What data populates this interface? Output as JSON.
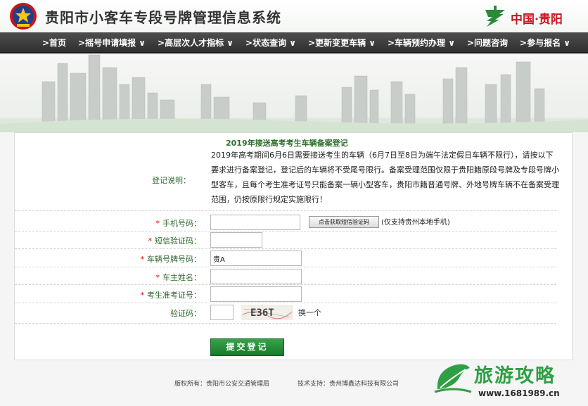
{
  "header": {
    "title": "贵阳市小客车专段号牌管理信息系统",
    "region_logo_text": "中国·贵阳",
    "police_logo_icon": "police-badge-icon"
  },
  "nav": {
    "items": [
      {
        "label": ">首页"
      },
      {
        "label": ">摇号申请填报 ∨"
      },
      {
        "label": ">高层次人才指标 ∨"
      },
      {
        "label": ">状态查询 ∨"
      },
      {
        "label": ">更新变更车辆 ∨"
      },
      {
        "label": ">车辆预约办理 ∨"
      },
      {
        "label": ">问题咨询"
      },
      {
        "label": ">参与报名 ∨"
      }
    ]
  },
  "form": {
    "title": "2019年接送高考考生车辆备案登记",
    "description_label": "登记说明：",
    "description": "2019年高考期间6月6日需要接送考生的车辆（6月7日至8日为端午法定假日车辆不限行），请按以下要求进行备案登记，登记后的车辆将不受尾号限行。备案受理范围仅限于贵阳籍原段号牌及专段号牌小型客车，且每个考生准考证号只能备案一辆小型客车，贵阳市籍普通号牌、外地号牌车辆不在备案受理范围，仍按原限行规定实施限行！",
    "required_mark": "*",
    "phone_label": "手机号码：",
    "phone_value": "",
    "sms_button_label": "点击获取短信验证码",
    "sms_note": "(仅支持贵州本地手机)",
    "sms_code_label": "短信验证码：",
    "sms_code_value": "",
    "plate_label": "车辆号牌号码：",
    "plate_value": "贵A",
    "owner_label": "车主姓名：",
    "owner_value": "",
    "exam_id_label": "考生准考证号：",
    "exam_id_value": "",
    "captcha_label": "验证码：",
    "captcha_value": "",
    "captcha_text": "E36T",
    "refresh_label": "换一个",
    "submit_label": "提交登记"
  },
  "footer": {
    "copyright": "版权所有：贵阳市公安交通管理局",
    "tech_support": "技术支持：贵州博鑫达科技有限公司"
  },
  "watermark": {
    "title": "旅游攻略",
    "url": "www.1681989.cn",
    "icon": "leaf-logo-icon"
  },
  "colors": {
    "nav_bg": "#3a3a3a",
    "label_green": "#2f6a2f",
    "title_green": "#2d6f2d",
    "submit_green": "#1f8a35",
    "required_red": "#dd0000",
    "region_red": "#c8161d"
  }
}
